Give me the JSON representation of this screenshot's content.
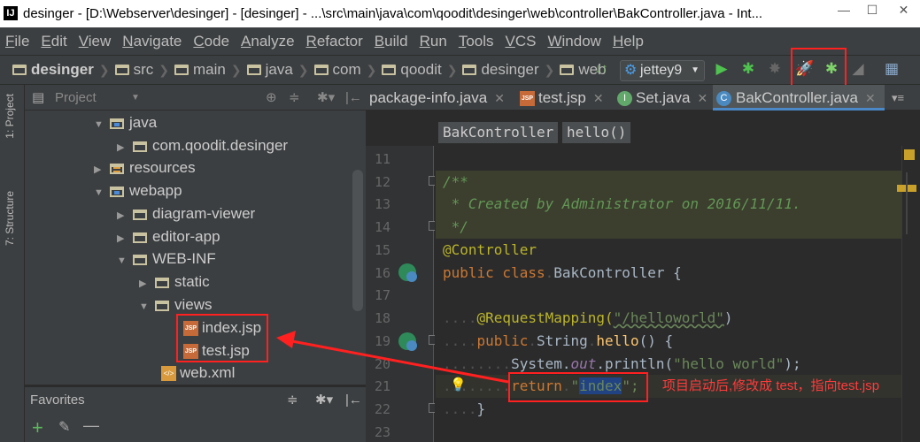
{
  "window": {
    "title": "desinger - [D:\\Webserver\\desinger] - [desinger] - ...\\src\\main\\java\\com\\qoodit\\desinger\\web\\controller\\BakController.java - Int..."
  },
  "menu": [
    "File",
    "Edit",
    "View",
    "Navigate",
    "Code",
    "Analyze",
    "Refactor",
    "Build",
    "Run",
    "Tools",
    "VCS",
    "Window",
    "Help"
  ],
  "navbar": {
    "crumbs": [
      "desinger",
      "src",
      "main",
      "java",
      "com",
      "qoodit",
      "desinger",
      "web"
    ],
    "run_config": "jettey9"
  },
  "left_strip": {
    "project_tab": "1: Project",
    "structure_tab": "7: Structure"
  },
  "project_panel": {
    "header": "Project",
    "tree": [
      {
        "label": "java",
        "arrow": "▼"
      },
      {
        "label": "com.qoodit.desinger",
        "arrow": "▶"
      },
      {
        "label": "resources",
        "arrow": "▶"
      },
      {
        "label": "webapp",
        "arrow": "▼"
      },
      {
        "label": "diagram-viewer",
        "arrow": "▶"
      },
      {
        "label": "editor-app",
        "arrow": "▶"
      },
      {
        "label": "WEB-INF",
        "arrow": "▼"
      },
      {
        "label": "static",
        "arrow": "▶"
      },
      {
        "label": "views",
        "arrow": "▼"
      },
      {
        "label": "index.jsp",
        "arrow": ""
      },
      {
        "label": "test.jsp",
        "arrow": ""
      },
      {
        "label": "web.xml",
        "arrow": ""
      }
    ],
    "favorites_header": "Favorites"
  },
  "tabs": [
    {
      "label": "package-info.java"
    },
    {
      "label": "test.jsp"
    },
    {
      "label": "Set.java"
    },
    {
      "label": "BakController.java"
    }
  ],
  "editor_breadcrumb": [
    "BakController",
    "hello()"
  ],
  "line_numbers": [
    "11",
    "12",
    "13",
    "14",
    "15",
    "16",
    "17",
    "18",
    "19",
    "20",
    "21",
    "22",
    "23"
  ],
  "code": {
    "l12": "/**",
    "l13": " * Created by Administrator on 2016/11/11.",
    "l14": " */",
    "l15": "@Controller",
    "l16_kw": "public class",
    "l16_rest": "BakController {",
    "l18_ann": "@RequestMapping(",
    "l18_str": "\"/helloworld\"",
    "l18_end": ")",
    "l19_kw": "public",
    "l19_type": "String",
    "l19_fn": "hello",
    "l19_end": "() {",
    "l20_a": "System.",
    "l20_out": "out",
    "l20_b": ".println(",
    "l20_str": "\"hello world\"",
    "l20_end": ");",
    "l21_kw": "return",
    "l21_q1": "\"",
    "l21_sel": "index",
    "l21_q2": "\";",
    "l22": "}"
  },
  "annotation_note": "项目启动后,修改成 test，指向test.jsp",
  "colors": {
    "annotation": "#ff2020"
  }
}
